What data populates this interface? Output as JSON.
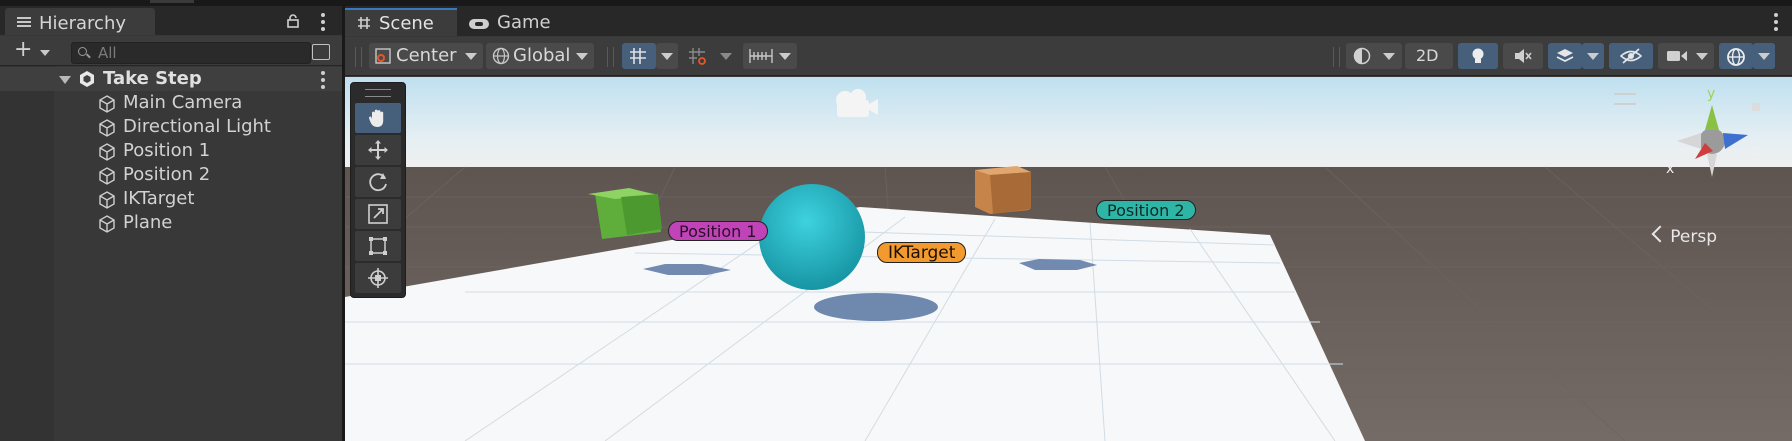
{
  "hierarchy": {
    "tab_label": "Hierarchy",
    "search_placeholder": "All",
    "scene_name": "Take Step",
    "items": [
      {
        "label": "Main Camera"
      },
      {
        "label": "Directional Light"
      },
      {
        "label": "Position 1"
      },
      {
        "label": "Position 2"
      },
      {
        "label": "IKTarget"
      },
      {
        "label": "Plane"
      }
    ]
  },
  "scene_view": {
    "tabs": [
      {
        "label": "Scene",
        "active": true,
        "icon": "hash-icon"
      },
      {
        "label": "Game",
        "active": false,
        "icon": "gamepad-icon"
      }
    ],
    "toolbar": {
      "pivot_mode": "Center",
      "pivot_rotation": "Global",
      "mode_2d": "2D"
    },
    "tools": [
      {
        "name": "hand-tool",
        "icon": "hand-icon",
        "active": true
      },
      {
        "name": "move-tool",
        "icon": "move-icon",
        "active": false
      },
      {
        "name": "rotate-tool",
        "icon": "rotate-icon",
        "active": false
      },
      {
        "name": "scale-tool",
        "icon": "scale-icon",
        "active": false
      },
      {
        "name": "rect-tool",
        "icon": "rect-icon",
        "active": false
      },
      {
        "name": "transform-tool",
        "icon": "transform-icon",
        "active": false
      }
    ],
    "labels": {
      "position1": "Position 1",
      "position2": "Position 2",
      "iktarget": "IKTarget"
    },
    "projection": "Persp",
    "axes": {
      "x": "x",
      "y": "y",
      "z": "z"
    }
  },
  "colors": {
    "accent": "#3a79bb",
    "active_button": "#46607c",
    "position1_label": "#c044b8",
    "position2_label": "#2fb5a5",
    "iktarget_label": "#f29a2e",
    "sphere": "#27c1cf",
    "green_block": "#6cc24a",
    "orange_block": "#c98a4e"
  }
}
